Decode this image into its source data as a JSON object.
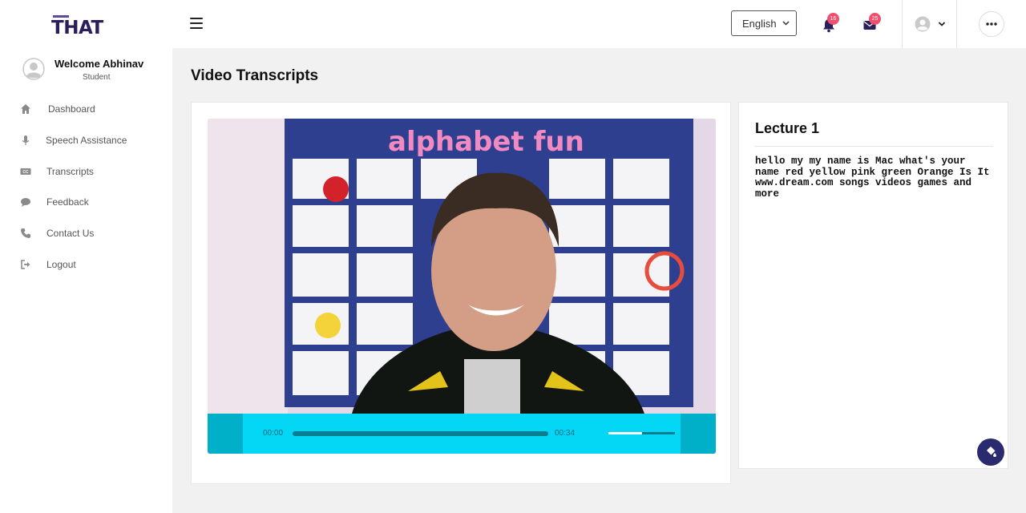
{
  "app": {
    "logo_text": "THAT"
  },
  "user": {
    "welcome": "Welcome Abhinav",
    "role": "Student"
  },
  "sidebar": {
    "items": [
      {
        "label": "Dashboard",
        "icon": "home-icon"
      },
      {
        "label": "Speech Assistance",
        "icon": "microphone-icon"
      },
      {
        "label": "Transcripts",
        "icon": "closed-captions-icon"
      },
      {
        "label": "Feedback",
        "icon": "comment-icon"
      },
      {
        "label": "Contact Us",
        "icon": "phone-icon"
      },
      {
        "label": "Logout",
        "icon": "logout-icon"
      }
    ]
  },
  "header": {
    "language": "English",
    "notifications_count": "16",
    "messages_count": "25"
  },
  "main": {
    "page_title": "Video Transcripts",
    "player": {
      "current_time": "00:00",
      "duration": "00:34",
      "progress": 0,
      "volume": 0.5
    },
    "transcript": {
      "title": "Lecture 1",
      "text": "hello my my name is Mac what's your name red yellow pink green Orange Is It www.dream.com songs videos games and more"
    }
  },
  "colors": {
    "brand": "#2a1e5c",
    "player_bar": "#03d7f5",
    "badge": "#f0506e",
    "fab": "#2a2a6e"
  }
}
